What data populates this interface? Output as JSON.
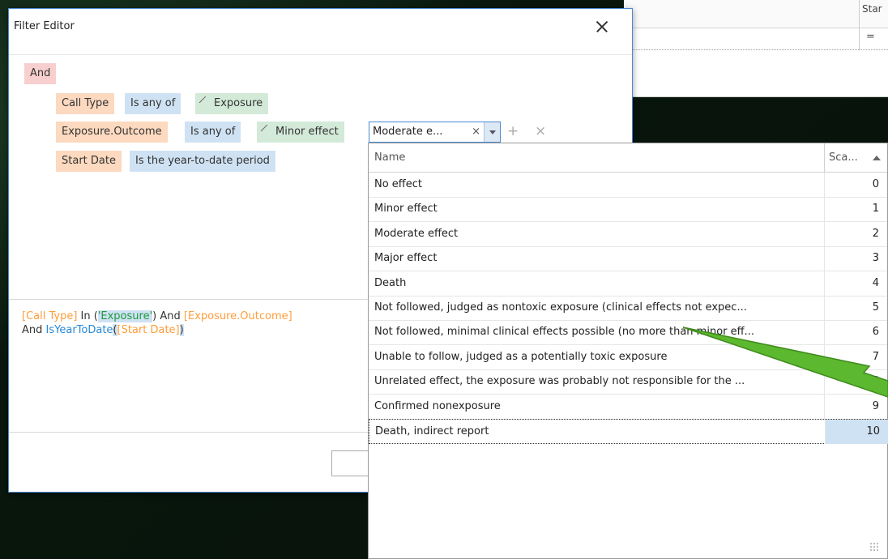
{
  "background": {
    "grid_header": "Star",
    "filter_symbol": "="
  },
  "dialog": {
    "title": "Filter Editor",
    "close_icon": "close-icon",
    "tree": {
      "group_op": "And",
      "conditions": [
        {
          "field": "Call Type",
          "operator": "Is any of",
          "values": [
            "Exposure"
          ]
        },
        {
          "field": "Exposure.Outcome",
          "operator": "Is any of",
          "values": [
            "Minor effect"
          ],
          "editing_value": "Moderate e...",
          "clear_glyph": "×",
          "add_glyph": "+",
          "remove_glyph": "×"
        },
        {
          "field": "Start Date",
          "operator": "Is the year-to-date period"
        }
      ]
    },
    "expression": {
      "line1_field1": "[Call Type]",
      "line1_in": " In (",
      "line1_str": "'Exposure'",
      "line1_close": ") And ",
      "line1_field2": "[Exposure.Outcome]",
      "line2_and": "And ",
      "line2_fn": "IsYearToDate",
      "line2_open": "(",
      "line2_arg": "[Start Date]",
      "line2_close": ")"
    }
  },
  "popup": {
    "columns": {
      "name": "Name",
      "scale": "Sca..."
    },
    "rows": [
      {
        "name": "No effect",
        "scale": "0"
      },
      {
        "name": "Minor effect",
        "scale": "1"
      },
      {
        "name": "Moderate effect",
        "scale": "2"
      },
      {
        "name": "Major effect",
        "scale": "3"
      },
      {
        "name": "Death",
        "scale": "4"
      },
      {
        "name": "Not followed, judged as nontoxic exposure (clinical effects not expec...",
        "scale": "5"
      },
      {
        "name": "Not followed, minimal clinical effects possible (no more than minor eff...",
        "scale": "6"
      },
      {
        "name": "Unable to follow, judged as a potentially toxic exposure",
        "scale": "7"
      },
      {
        "name": "Unrelated effect, the exposure was probably not responsible for the ...",
        "scale": "8"
      },
      {
        "name": "Confirmed nonexposure",
        "scale": "9"
      },
      {
        "name": "Death, indirect report",
        "scale": "10"
      }
    ],
    "focused_row": 10,
    "accent": "#4a8ad4",
    "annotation_arrow_color": "#5cb82e"
  }
}
